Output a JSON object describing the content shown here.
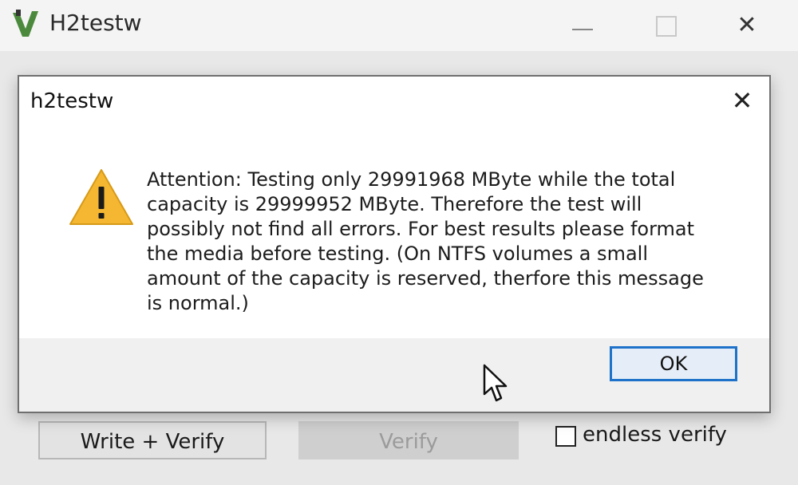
{
  "main_window": {
    "title": "H2testw",
    "controls": {
      "minimize": "minimize-icon",
      "maximize": "maximize-icon",
      "close": "✕"
    },
    "buttons": {
      "write_verify": "Write + Verify",
      "verify": "Verify"
    },
    "endless_verify": {
      "label": "endless verify",
      "checked": false
    }
  },
  "dialog": {
    "title": "h2testw",
    "close": "✕",
    "icon": "warning-icon",
    "message": "Attention: Testing only 29991968 MByte while the total capacity is 29999952 MByte. Therefore the test will possibly not find all errors. For best results please format the media before testing. (On NTFS volumes a small amount of the capacity is reserved, therfore this message is normal.)",
    "ok_label": "OK"
  },
  "colors": {
    "accent": "#1e72c9",
    "warning_fill": "#f5b731"
  }
}
